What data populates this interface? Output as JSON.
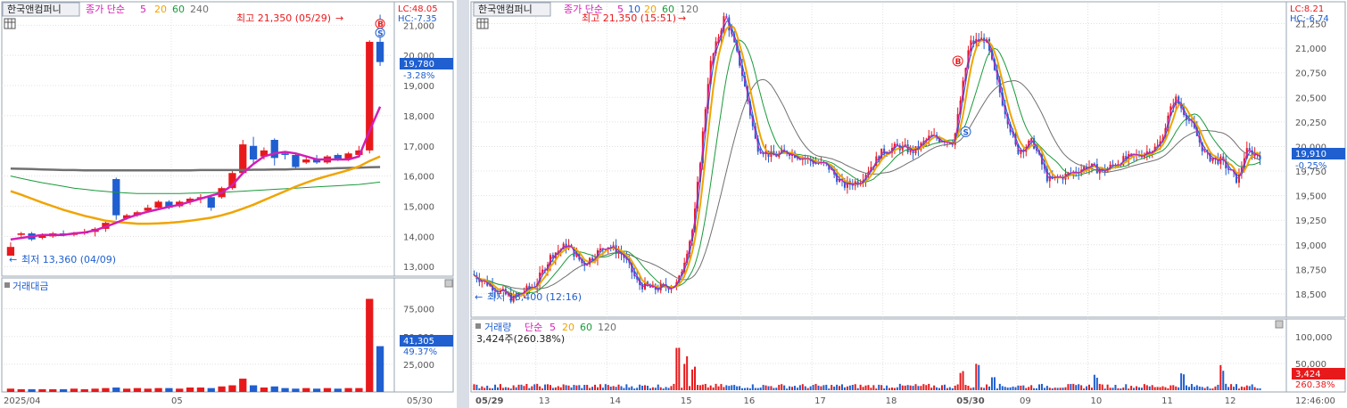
{
  "colors": {
    "up": "#e8191b",
    "down": "#1f5fd0",
    "ma5": "#d21fb4",
    "ma20": "#f0a400",
    "ma60": "#1a9a3a",
    "ma120": "#707070",
    "grid": "#e0e0e0",
    "price_box": "#1f5fd0",
    "vol_box": "#e8191b"
  },
  "left_panel": {
    "stock_name": "한국앤컴퍼니",
    "legend": {
      "prefix": "종가 단순",
      "ma5": "5",
      "ma20": "20",
      "ma60": "60",
      "ma120": "240"
    },
    "lc": "LC:48.05",
    "hc": "HC:-7.35",
    "high_label": "최고 21,350 (05/29)",
    "low_label": "최저 13,360 (04/09)",
    "current_price": "19,780",
    "current_change": "-3.28%",
    "volume_title": "거래대금",
    "volume_value": "41,305",
    "volume_change": "49.37%",
    "x_labels": [
      "2025/04",
      "05",
      "05/30"
    ],
    "price_ticks": [
      "21,000",
      "20,000",
      "19,000",
      "18,000",
      "17,000",
      "16,000",
      "15,000",
      "14,000",
      "13,000"
    ],
    "volume_ticks": [
      "75,000",
      "50,000",
      "25,000"
    ]
  },
  "right_panel": {
    "stock_name": "한국앤컴퍼니",
    "legend": {
      "prefix": "종가 단순",
      "ma5": "5",
      "ma10": "10",
      "ma20": "20",
      "ma60": "60",
      "ma120": "120"
    },
    "lc": "LC:8.21",
    "hc": "HC:-6.74",
    "high_label": "최고 21,350 (15:51)",
    "low_label": "최저 18,400 (12:16)",
    "current_price": "19,910",
    "current_change": "-0.25%",
    "volume_title": "거래량",
    "volume_legend": {
      "prefix": "단순",
      "ma5": "5",
      "ma20": "20",
      "ma60": "60",
      "ma120": "120"
    },
    "volume_info": "3,424주(260.38%)",
    "volume_value": "3,424",
    "volume_change": "260.38%",
    "time": "12:46:00",
    "x_labels": [
      "05/29",
      "13",
      "14",
      "15",
      "16",
      "17",
      "18",
      "05/30",
      "09",
      "10",
      "11",
      "12"
    ],
    "price_ticks": [
      "21,250",
      "21,000",
      "20,750",
      "20,500",
      "20,250",
      "20,000",
      "19,750",
      "19,500",
      "19,250",
      "19,000",
      "18,750",
      "18,500"
    ],
    "volume_ticks": [
      "100,000",
      "50,000"
    ]
  },
  "chart_data": [
    {
      "type": "candlestick",
      "title": "한국앤컴퍼니",
      "period": "daily",
      "ylim": [
        12800,
        21600
      ],
      "candles": [
        {
          "o": 13360,
          "h": 13800,
          "l": 13360,
          "c": 13650
        },
        {
          "o": 14050,
          "h": 14150,
          "l": 13950,
          "c": 14100
        },
        {
          "o": 14100,
          "h": 14150,
          "l": 13850,
          "c": 13900
        },
        {
          "o": 13950,
          "h": 14100,
          "l": 13900,
          "c": 14050
        },
        {
          "o": 14000,
          "h": 14150,
          "l": 13950,
          "c": 14100
        },
        {
          "o": 14100,
          "h": 14200,
          "l": 14000,
          "c": 14050
        },
        {
          "o": 14050,
          "h": 14150,
          "l": 14000,
          "c": 14100
        },
        {
          "o": 14100,
          "h": 14250,
          "l": 14050,
          "c": 14150
        },
        {
          "o": 14150,
          "h": 14300,
          "l": 14000,
          "c": 14250
        },
        {
          "o": 14250,
          "h": 14500,
          "l": 14150,
          "c": 14450
        },
        {
          "o": 15900,
          "h": 15950,
          "l": 14550,
          "c": 14700
        },
        {
          "o": 14600,
          "h": 14750,
          "l": 14550,
          "c": 14700
        },
        {
          "o": 14700,
          "h": 14850,
          "l": 14650,
          "c": 14800
        },
        {
          "o": 14850,
          "h": 15050,
          "l": 14800,
          "c": 14950
        },
        {
          "o": 14950,
          "h": 15200,
          "l": 14900,
          "c": 15150
        },
        {
          "o": 15150,
          "h": 15200,
          "l": 14900,
          "c": 14950
        },
        {
          "o": 15000,
          "h": 15200,
          "l": 14950,
          "c": 15150
        },
        {
          "o": 15150,
          "h": 15300,
          "l": 15050,
          "c": 15250
        },
        {
          "o": 15250,
          "h": 15400,
          "l": 15100,
          "c": 15300
        },
        {
          "o": 15300,
          "h": 15350,
          "l": 14850,
          "c": 14950
        },
        {
          "o": 15300,
          "h": 15650,
          "l": 15250,
          "c": 15600
        },
        {
          "o": 15600,
          "h": 16200,
          "l": 15550,
          "c": 16100
        },
        {
          "o": 16100,
          "h": 17200,
          "l": 16050,
          "c": 17050
        },
        {
          "o": 17000,
          "h": 17300,
          "l": 16400,
          "c": 16550
        },
        {
          "o": 16650,
          "h": 16950,
          "l": 16550,
          "c": 16850
        },
        {
          "o": 17200,
          "h": 17250,
          "l": 16350,
          "c": 16600
        },
        {
          "o": 16750,
          "h": 16800,
          "l": 16550,
          "c": 16700
        },
        {
          "o": 16700,
          "h": 16750,
          "l": 16250,
          "c": 16300
        },
        {
          "o": 16450,
          "h": 16650,
          "l": 16400,
          "c": 16550
        },
        {
          "o": 16550,
          "h": 16700,
          "l": 16400,
          "c": 16450
        },
        {
          "o": 16450,
          "h": 16700,
          "l": 16400,
          "c": 16650
        },
        {
          "o": 16700,
          "h": 16750,
          "l": 16500,
          "c": 16550
        },
        {
          "o": 16550,
          "h": 16800,
          "l": 16500,
          "c": 16750
        },
        {
          "o": 16700,
          "h": 17000,
          "l": 16650,
          "c": 16850
        },
        {
          "o": 16850,
          "h": 20500,
          "l": 16750,
          "c": 20450
        },
        {
          "o": 20450,
          "h": 21350,
          "l": 19650,
          "c": 19780
        }
      ],
      "ma5": [
        13900,
        13950,
        14000,
        14050,
        14050,
        14050,
        14100,
        14130,
        14200,
        14320,
        14450,
        14600,
        14720,
        14820,
        14900,
        14980,
        15050,
        15150,
        15250,
        15350,
        15450,
        15700,
        16100,
        16400,
        16650,
        16750,
        16800,
        16750,
        16650,
        16550,
        16550,
        16550,
        16550,
        16650,
        17500,
        18300
      ],
      "ma20": [
        15500,
        15380,
        15250,
        15120,
        15000,
        14880,
        14780,
        14680,
        14600,
        14520,
        14480,
        14450,
        14420,
        14420,
        14430,
        14450,
        14480,
        14520,
        14570,
        14620,
        14700,
        14800,
        14920,
        15050,
        15200,
        15350,
        15500,
        15650,
        15780,
        15900,
        16000,
        16100,
        16200,
        16320,
        16500,
        16650
      ],
      "ma60": [
        16000,
        15920,
        15850,
        15780,
        15720,
        15660,
        15600,
        15560,
        15520,
        15490,
        15460,
        15440,
        15420,
        15420,
        15420,
        15420,
        15420,
        15430,
        15440,
        15450,
        15460,
        15480,
        15500,
        15520,
        15540,
        15560,
        15580,
        15600,
        15620,
        15640,
        15660,
        15680,
        15700,
        15720,
        15760,
        15800
      ],
      "ma120": [
        16250,
        16240,
        16230,
        16220,
        16210,
        16200,
        16200,
        16190,
        16190,
        16190,
        16190,
        16190,
        16190,
        16190,
        16190,
        16190,
        16190,
        16190,
        16200,
        16200,
        16200,
        16200,
        16200,
        16210,
        16210,
        16220,
        16220,
        16230,
        16230,
        16240,
        16250,
        16260,
        16270,
        16280,
        16290,
        16300
      ],
      "volume": [
        3000,
        2500,
        2500,
        2500,
        2500,
        2500,
        3000,
        2500,
        3000,
        3500,
        4000,
        3000,
        3500,
        3000,
        3500,
        3500,
        3000,
        4000,
        4000,
        3500,
        5000,
        6000,
        12000,
        6000,
        4000,
        5000,
        3500,
        3000,
        3500,
        3000,
        3500,
        3000,
        3500,
        3500,
        84000,
        41305
      ],
      "volume_ylim": [
        0,
        90000
      ]
    },
    {
      "type": "candlestick",
      "title": "한국앤컴퍼니",
      "period": "intraday",
      "ylim": [
        18300,
        21400
      ],
      "segments": [
        {
          "label": "05/29",
          "start": 0,
          "end": 0.08,
          "path": [
            [
              0,
              18700
            ],
            [
              0.02,
              18600
            ],
            [
              0.05,
              18450
            ],
            [
              0.08,
              18600
            ]
          ]
        },
        {
          "label": "13",
          "start": 0.08,
          "end": 0.17,
          "path": [
            [
              0,
              18600
            ],
            [
              0.02,
              18900
            ],
            [
              0.04,
              19000
            ],
            [
              0.06,
              18800
            ],
            [
              0.09,
              19000
            ]
          ]
        },
        {
          "label": "14",
          "start": 0.17,
          "end": 0.26,
          "path": [
            [
              0,
              19000
            ],
            [
              0.02,
              18900
            ],
            [
              0.04,
              18600
            ],
            [
              0.06,
              18550
            ],
            [
              0.09,
              18600
            ]
          ]
        },
        {
          "label": "15",
          "start": 0.26,
          "end": 0.34,
          "path": [
            [
              0,
              18600
            ],
            [
              0.02,
              19200
            ],
            [
              0.04,
              20800
            ],
            [
              0.06,
              21350
            ],
            [
              0.08,
              20800
            ]
          ]
        },
        {
          "label": "16",
          "start": 0.34,
          "end": 0.43,
          "path": [
            [
              0,
              20800
            ],
            [
              0.02,
              20000
            ],
            [
              0.04,
              19900
            ],
            [
              0.06,
              19950
            ],
            [
              0.09,
              19850
            ]
          ]
        },
        {
          "label": "17",
          "start": 0.43,
          "end": 0.52,
          "path": [
            [
              0,
              19850
            ],
            [
              0.02,
              19800
            ],
            [
              0.04,
              19600
            ],
            [
              0.06,
              19650
            ],
            [
              0.09,
              19950
            ]
          ]
        },
        {
          "label": "18",
          "start": 0.52,
          "end": 0.61,
          "path": [
            [
              0,
              19950
            ],
            [
              0.02,
              20000
            ],
            [
              0.04,
              19950
            ],
            [
              0.06,
              20100
            ],
            [
              0.09,
              20050
            ]
          ]
        },
        {
          "label": "05/30",
          "start": 0.61,
          "end": 0.69,
          "path": [
            [
              0,
              20050
            ],
            [
              0.02,
              21050
            ],
            [
              0.04,
              21100
            ],
            [
              0.06,
              20500
            ],
            [
              0.08,
              19950
            ]
          ]
        },
        {
          "label": "09",
          "start": 0.69,
          "end": 0.78,
          "path": [
            [
              0,
              19950
            ],
            [
              0.02,
              20050
            ],
            [
              0.04,
              19650
            ],
            [
              0.06,
              19700
            ],
            [
              0.09,
              19800
            ]
          ]
        },
        {
          "label": "10",
          "start": 0.78,
          "end": 0.87,
          "path": [
            [
              0,
              19800
            ],
            [
              0.02,
              19750
            ],
            [
              0.04,
              19850
            ],
            [
              0.06,
              19900
            ],
            [
              0.09,
              20000
            ]
          ]
        },
        {
          "label": "11",
          "start": 0.87,
          "end": 0.95,
          "path": [
            [
              0,
              20000
            ],
            [
              0.02,
              20500
            ],
            [
              0.04,
              20250
            ],
            [
              0.06,
              19900
            ],
            [
              0.08,
              19850
            ]
          ]
        },
        {
          "label": "12",
          "start": 0.95,
          "end": 1.0,
          "path": [
            [
              0,
              19850
            ],
            [
              0.02,
              19650
            ],
            [
              0.03,
              19950
            ],
            [
              0.05,
              19910
            ]
          ]
        }
      ],
      "volume_ylim": [
        0,
        110000
      ]
    }
  ]
}
